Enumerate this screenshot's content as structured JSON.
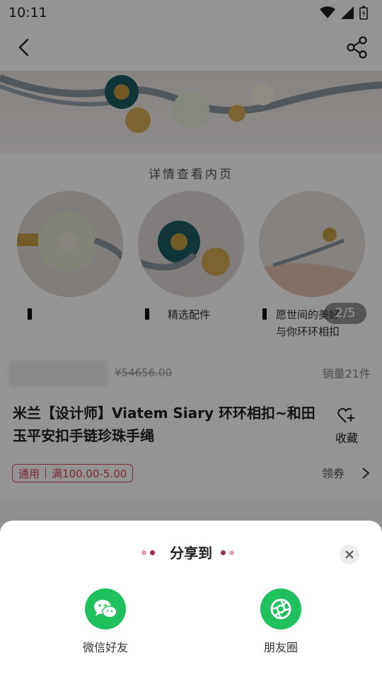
{
  "status_bar": {
    "time": "10:11"
  },
  "product": {
    "detail_heading": "详情查看内页",
    "captions": [
      "精选配件",
      "愿世间的美好",
      "与你环环相扣"
    ],
    "page_indicator": "2/5",
    "original_price": "¥54656.00",
    "sales": "销量21件",
    "title": "米兰【设计师】Viatem Siary 环环相扣~和田玉平安扣手链珍珠手绳",
    "favorite_label": "收藏",
    "coupon_type": "通用",
    "coupon_value": "满100.00-5.00",
    "get_coupon": "领券"
  },
  "share_sheet": {
    "title": "分享到",
    "options": [
      {
        "label": "微信好友",
        "icon": "wechat-icon"
      },
      {
        "label": "朋友圈",
        "icon": "moments-icon"
      }
    ]
  },
  "colors": {
    "accent": "#d6455c",
    "share_green": "#1fc15c",
    "dot_dark": "#a32f45",
    "dot_light": "#e8a0b0"
  }
}
